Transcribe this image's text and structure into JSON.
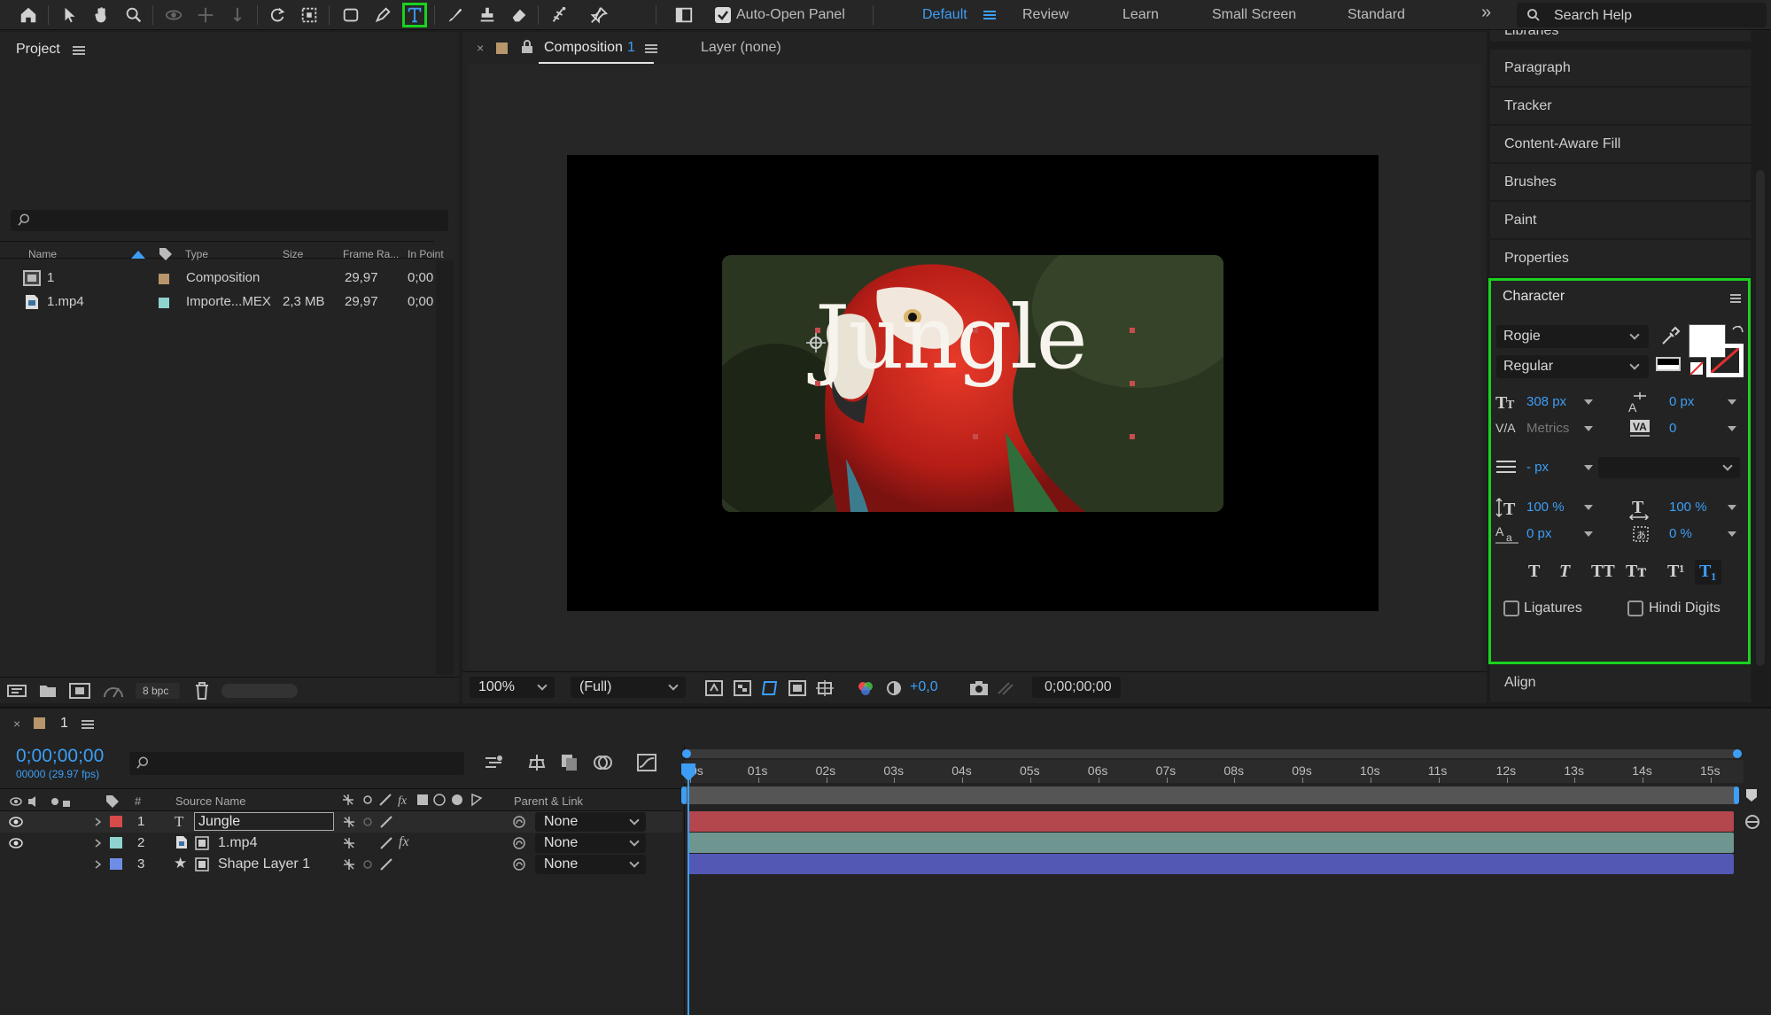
{
  "toolbar": {
    "tools": [
      "home-icon",
      "selection-icon",
      "hand-icon",
      "zoom-icon",
      "orbit-icon",
      "pan-icon",
      "dolly-icon",
      "rotate-icon",
      "region-icon",
      "rectangle-icon",
      "pen-icon",
      "type-icon",
      "brush-icon",
      "stamp-icon",
      "eraser-icon",
      "roto-brush-icon",
      "puppet-icon"
    ],
    "auto_open_label": "Auto-Open Panel",
    "workspaces": [
      "Default",
      "Review",
      "Learn",
      "Small Screen",
      "Standard"
    ],
    "active_workspace": "Default",
    "search_placeholder": "Search Help"
  },
  "project": {
    "title": "Project",
    "columns": [
      "Name",
      "Type",
      "Size",
      "Frame Ra...",
      "In Point"
    ],
    "rows": [
      {
        "name": "1",
        "type": "Composition",
        "size": "",
        "frame_rate": "29,97",
        "in_point": "0;00",
        "color": "#b8956a"
      },
      {
        "name": "1.mp4",
        "type": "Importe...MEX",
        "size": "2,3 MB",
        "frame_rate": "29,97",
        "in_point": "0;00",
        "color": "#8fd3d0"
      }
    ],
    "bpc": "8 bpc"
  },
  "composition": {
    "tab_label": "Composition",
    "tab_name": "1",
    "layer_label": "Layer (none)",
    "breadcrumb": "1",
    "overlay_text": "Jungle",
    "zoom": "100%",
    "resolution": "(Full)",
    "exposure": "+0,0",
    "timecode": "0;00;00;00"
  },
  "right_panel": {
    "items_top": [
      "Libraries",
      "Paragraph",
      "Tracker",
      "Content-Aware Fill",
      "Brushes",
      "Paint",
      "Properties"
    ],
    "align_label": "Align"
  },
  "character": {
    "title": "Character",
    "font_family": "Rogie",
    "font_style": "Regular",
    "font_size": "308 px",
    "leading": "0 px",
    "kerning": "Metrics",
    "tracking": "0",
    "stroke_width": "- px",
    "vertical_scale": "100 %",
    "horizontal_scale": "100 %",
    "baseline_shift": "0 px",
    "tsume": "0 %",
    "style_buttons": [
      "T",
      "T",
      "TT",
      "Tт",
      "T¹",
      "T₁"
    ],
    "ligatures_label": "Ligatures",
    "hindi_digits_label": "Hindi Digits"
  },
  "timeline": {
    "comp_name": "1",
    "timecode": "0;00;00;00",
    "fps": "00000 (29.97 fps)",
    "col_number": "#",
    "col_source": "Source Name",
    "col_parent": "Parent & Link",
    "ruler": [
      "0s",
      "01s",
      "02s",
      "03s",
      "04s",
      "05s",
      "06s",
      "07s",
      "08s",
      "09s",
      "10s",
      "11s",
      "12s",
      "13s",
      "14s",
      "15s"
    ],
    "layers": [
      {
        "num": "1",
        "name": "Jungle",
        "type": "text",
        "color": "#d64a4a",
        "parent": "None",
        "bar_color": "#b3474d"
      },
      {
        "num": "2",
        "name": "1.mp4",
        "type": "footage",
        "color": "#8fd3d0",
        "parent": "None",
        "bar_color": "#6f9590"
      },
      {
        "num": "3",
        "name": "Shape Layer 1",
        "type": "shape",
        "color": "#6e8de6",
        "parent": "None",
        "bar_color": "#5258b3"
      }
    ]
  }
}
